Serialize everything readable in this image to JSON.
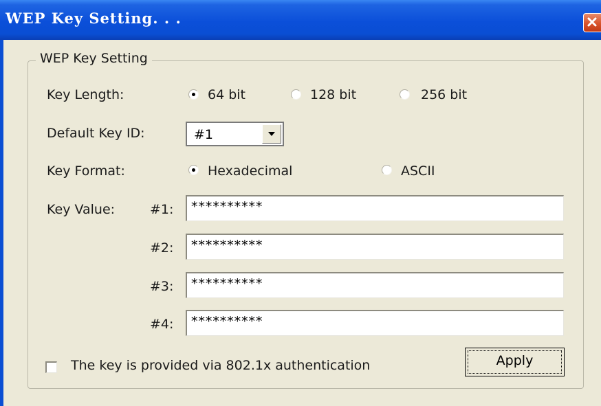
{
  "window": {
    "title": "WEP Key Setting. . .",
    "close_icon": "close-icon"
  },
  "group": {
    "label": "WEP Key Setting"
  },
  "key_length": {
    "label": "Key Length:",
    "options": [
      "64 bit",
      "128 bit",
      "256 bit"
    ],
    "selected": "64 bit"
  },
  "default_key_id": {
    "label": "Default Key ID:",
    "value": "#1",
    "arrow_icon": "chevron-down-icon"
  },
  "key_format": {
    "label": "Key Format:",
    "options": [
      "Hexadecimal",
      "ASCII"
    ],
    "selected": "Hexadecimal"
  },
  "key_value": {
    "label": "Key Value:",
    "keys": [
      {
        "label": "#1:",
        "value": "**********"
      },
      {
        "label": "#2:",
        "value": "**********"
      },
      {
        "label": "#3:",
        "value": "**********"
      },
      {
        "label": "#4:",
        "value": "**********"
      }
    ]
  },
  "auth_checkbox": {
    "label": "The key is provided via 802.1x authentication",
    "checked": false
  },
  "apply_button": {
    "label": "Apply"
  },
  "colors": {
    "titlebar": "#0a4ed3",
    "dialog_bg": "#ece9d8",
    "close_button": "#d8532b"
  }
}
